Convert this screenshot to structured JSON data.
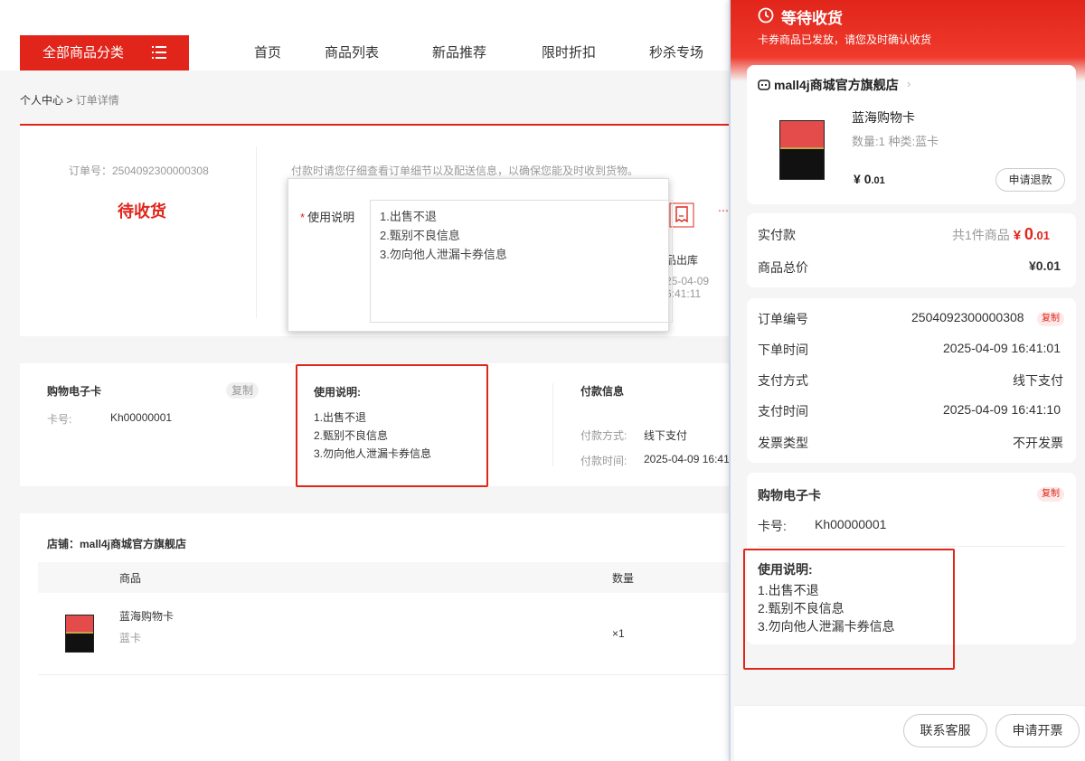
{
  "nav": {
    "category_label": "全部商品分类",
    "items": [
      "首页",
      "商品列表",
      "新品推荐",
      "限时折扣",
      "秒杀专场"
    ]
  },
  "breadcrumb": {
    "home": "个人中心",
    "sep": ">",
    "current": "订单详情"
  },
  "order": {
    "number_text": "订单号：2504092300000308",
    "status": "待收货",
    "tip": "付款时请您仔细查看订单细节以及配送信息，以确保您能及时收到货物。",
    "step_label": "品出库",
    "step_time1": "25-04-09",
    "step_time2": "6:41:11",
    "step_dots": "⋯"
  },
  "popup": {
    "required": "*",
    "label": "使用说明",
    "lines": [
      "1.出售不退",
      "2.甄别不良信息",
      "3.勿向他人泄漏卡券信息"
    ]
  },
  "card_info": {
    "title": "购物电子卡",
    "copy": "复制",
    "card_no_label": "卡号:",
    "card_no": "Kh00000001"
  },
  "usage": {
    "title": "使用说明:",
    "lines": [
      "1.出售不退",
      "2.甄别不良信息",
      "3.勿向他人泄漏卡券信息"
    ]
  },
  "payment": {
    "title": "付款信息",
    "method_label": "付款方式:",
    "method": "线下支付",
    "time_label": "付款时间:",
    "time": "2025-04-09 16:41"
  },
  "shop_section": {
    "shop_line": "店铺：mall4j商城官方旗舰店",
    "col_product": "商品",
    "col_qty": "数量",
    "product_name": "蓝海购物卡",
    "product_spec": "蓝卡",
    "qty": "×1"
  },
  "mobile": {
    "status": "等待收货",
    "sub": "卡券商品已发放，请您及时确认收货",
    "shop": "mall4j商城官方旗舰店",
    "shop_arrow": "›",
    "product_name": "蓝海购物卡",
    "product_spec": "数量:1   种类:蓝卡",
    "price_symbol": "¥",
    "price_int": "0",
    "price_dec": ".01",
    "refund_btn": "申请退款",
    "paid_label": "实付款",
    "paid_count": "共1件商品",
    "paid_symbol": "¥",
    "paid_int": "0",
    "paid_dec": ".01",
    "total_label": "商品总价",
    "total_value": "¥0.01",
    "order_no_label": "订单编号",
    "order_no": "2504092300000308",
    "copy": "复制",
    "order_time_label": "下单时间",
    "order_time": "2025-04-09 16:41:01",
    "pay_method_label": "支付方式",
    "pay_method": "线下支付",
    "pay_time_label": "支付时间",
    "pay_time": "2025-04-09 16:41:10",
    "invoice_label": "发票类型",
    "invoice": "不开发票",
    "ecard_title": "购物电子卡",
    "ecard_copy": "复制",
    "card_no_label": "卡号:",
    "card_no": "Kh00000001",
    "usage_title": "使用说明:",
    "usage_lines": [
      "1.出售不退",
      "2.甄别不良信息",
      "3.勿向他人泄漏卡券信息"
    ],
    "contact_btn": "联系客服",
    "invoice_btn": "申请开票"
  },
  "colors": {
    "accent": "#e1251b",
    "highlight_box": "#e1251b"
  },
  "icons": {
    "menu": "menu-icon",
    "clock": "clock-icon",
    "shop": "shop-icon",
    "receipt": "receipt-icon"
  }
}
